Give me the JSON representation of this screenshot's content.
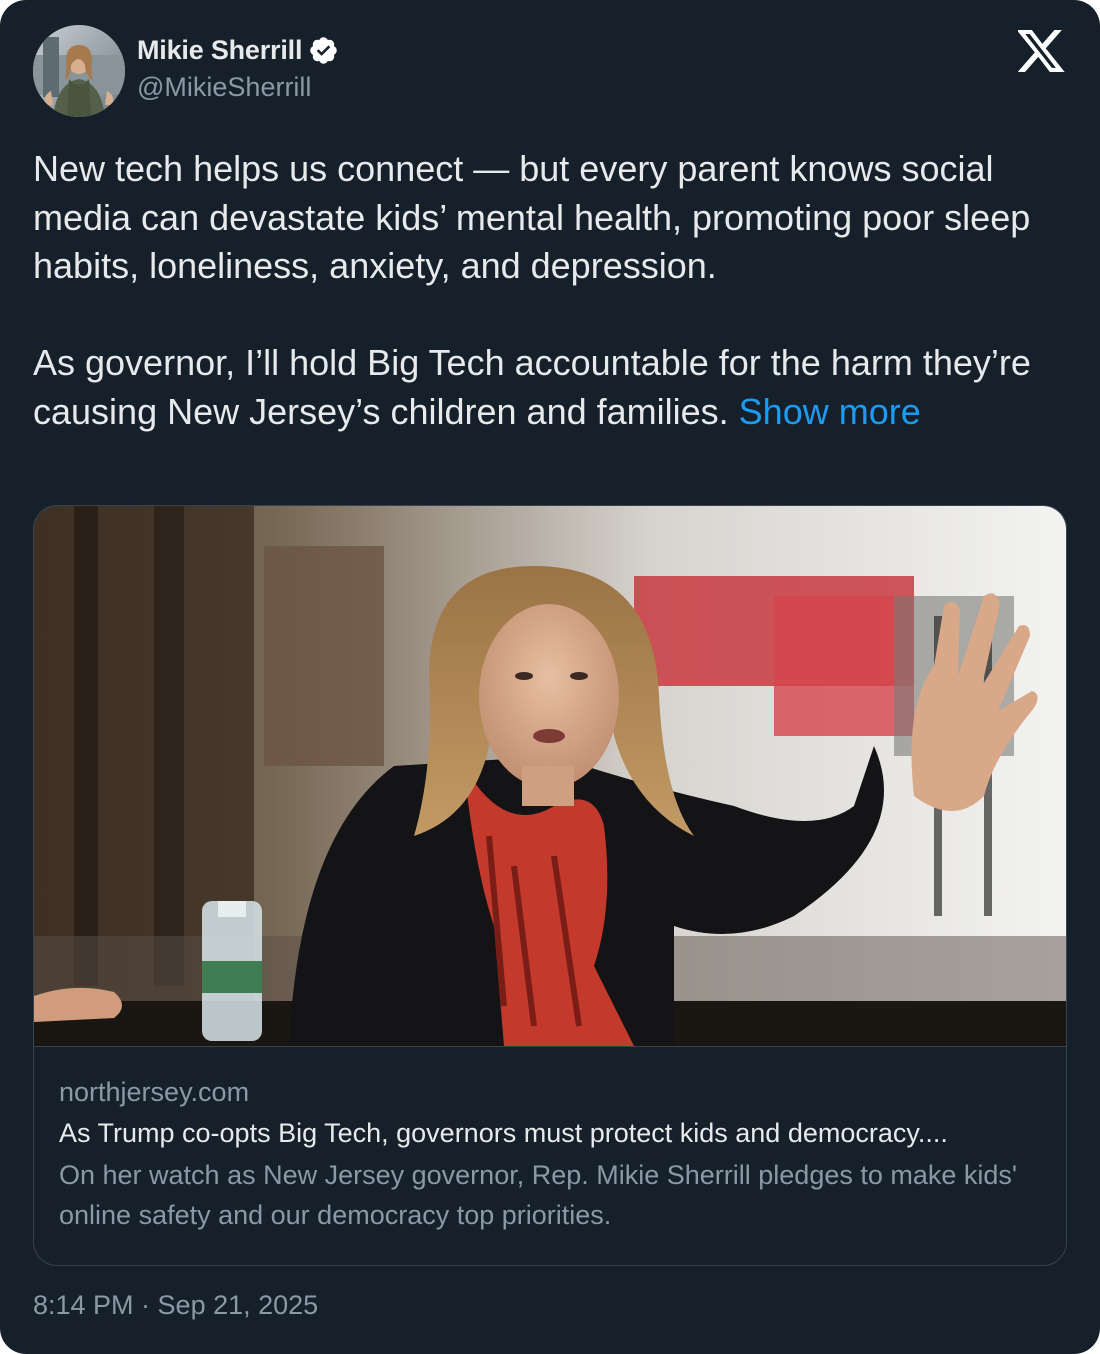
{
  "author": {
    "display_name": "Mikie Sherrill",
    "handle": "@MikieSherrill",
    "verified": true,
    "avatar_icon": "profile-photo"
  },
  "brand": {
    "logo_icon": "x-logo-icon"
  },
  "tweet": {
    "paragraph_1": "New tech helps us connect — but every parent knows social media can devastate kids’ mental health, promoting poor sleep habits, loneliness, anxiety, and depression.",
    "paragraph_2": "As governor, I’ll hold Big Tech accountable for the harm they’re causing New Jersey’s children and families. ",
    "show_more_label": "Show more"
  },
  "link_card": {
    "image_icon": "article-photo",
    "domain": "northjersey.com",
    "title": "As Trump co-opts Big Tech, governors must protect kids and democracy....",
    "description": "On her watch as New Jersey governor, Rep. Mikie Sherrill pledges to make kids' online safety and our democracy top priorities."
  },
  "timestamp": "8:14 PM · Sep 21, 2025",
  "colors": {
    "background": "#15202b",
    "text_primary": "#e7e9ea",
    "text_secondary": "#8b98a5",
    "link_accent": "#1d9bf0",
    "border": "#38444d",
    "verified_badge": "#ffffff"
  }
}
